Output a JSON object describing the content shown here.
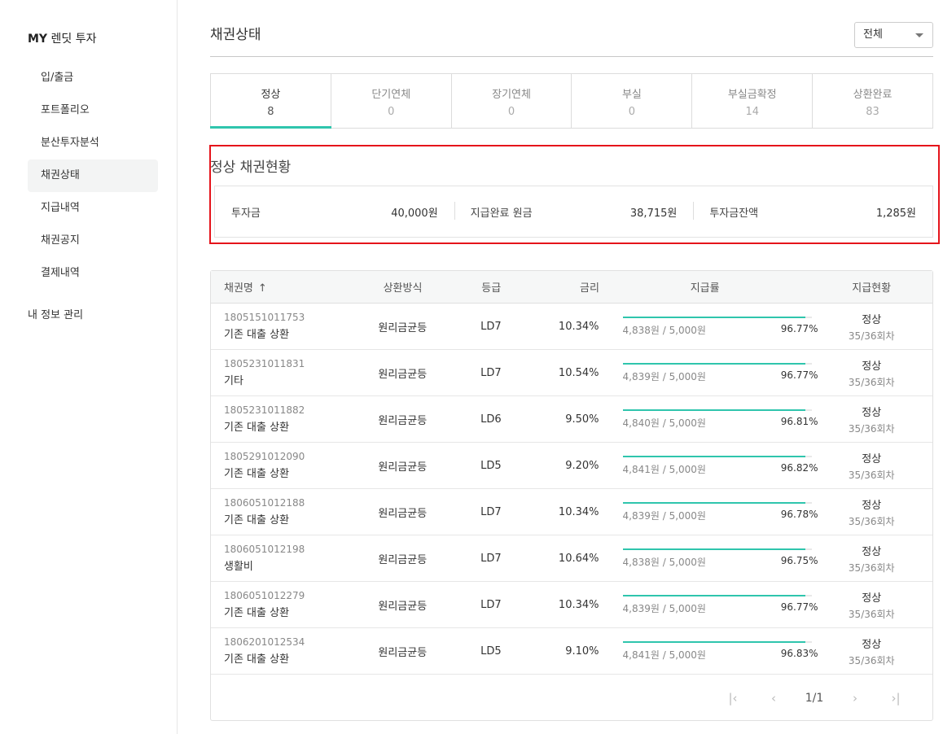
{
  "sidebar": {
    "brand_bold": "MY",
    "brand_rest": "렌딧 투자",
    "items": [
      {
        "label": "입/출금"
      },
      {
        "label": "포트폴리오"
      },
      {
        "label": "분산투자분석"
      },
      {
        "label": "채권상태"
      },
      {
        "label": "지급내역"
      },
      {
        "label": "채권공지"
      },
      {
        "label": "결제내역"
      }
    ],
    "active_index": 3,
    "account": "내 정보 관리"
  },
  "header": {
    "title": "채권상태",
    "filter_value": "전체"
  },
  "tabs": [
    {
      "label": "정상",
      "count": "8"
    },
    {
      "label": "단기연체",
      "count": "0"
    },
    {
      "label": "장기연체",
      "count": "0"
    },
    {
      "label": "부실",
      "count": "0"
    },
    {
      "label": "부실금확정",
      "count": "14"
    },
    {
      "label": "상환완료",
      "count": "83"
    }
  ],
  "summary": {
    "title": "정상 채권현황",
    "invest_label": "투자금",
    "invest_value": "40,000원",
    "paid_label": "지급완료 원금",
    "paid_value": "38,715원",
    "balance_label": "투자금잔액",
    "balance_value": "1,285원"
  },
  "table": {
    "headers": {
      "name": "채권명",
      "sort_icon": "↑",
      "method": "상환방식",
      "grade": "등급",
      "rate": "금리",
      "payout": "지급률",
      "status": "지급현황"
    },
    "rows": [
      {
        "id": "1805151011753",
        "name": "기존 대출 상환",
        "method": "원리금균등",
        "grade": "LD7",
        "rate": "10.34%",
        "paid": "4,838원 / 5,000원",
        "pct": "96.77%",
        "pct_value": 96.77,
        "status": "정상",
        "rounds": "35/36회차"
      },
      {
        "id": "1805231011831",
        "name": "기타",
        "method": "원리금균등",
        "grade": "LD7",
        "rate": "10.54%",
        "paid": "4,839원 / 5,000원",
        "pct": "96.77%",
        "pct_value": 96.77,
        "status": "정상",
        "rounds": "35/36회차"
      },
      {
        "id": "1805231011882",
        "name": "기존 대출 상환",
        "method": "원리금균등",
        "grade": "LD6",
        "rate": "9.50%",
        "paid": "4,840원 / 5,000원",
        "pct": "96.81%",
        "pct_value": 96.81,
        "status": "정상",
        "rounds": "35/36회차"
      },
      {
        "id": "1805291012090",
        "name": "기존 대출 상환",
        "method": "원리금균등",
        "grade": "LD5",
        "rate": "9.20%",
        "paid": "4,841원 / 5,000원",
        "pct": "96.82%",
        "pct_value": 96.82,
        "status": "정상",
        "rounds": "35/36회차"
      },
      {
        "id": "1806051012188",
        "name": "기존 대출 상환",
        "method": "원리금균등",
        "grade": "LD7",
        "rate": "10.34%",
        "paid": "4,839원 / 5,000원",
        "pct": "96.78%",
        "pct_value": 96.78,
        "status": "정상",
        "rounds": "35/36회차"
      },
      {
        "id": "1806051012198",
        "name": "생활비",
        "method": "원리금균등",
        "grade": "LD7",
        "rate": "10.64%",
        "paid": "4,838원 / 5,000원",
        "pct": "96.75%",
        "pct_value": 96.75,
        "status": "정상",
        "rounds": "35/36회차"
      },
      {
        "id": "1806051012279",
        "name": "기존 대출 상환",
        "method": "원리금균등",
        "grade": "LD7",
        "rate": "10.34%",
        "paid": "4,839원 / 5,000원",
        "pct": "96.77%",
        "pct_value": 96.77,
        "status": "정상",
        "rounds": "35/36회차"
      },
      {
        "id": "1806201012534",
        "name": "기존 대출 상환",
        "method": "원리금균등",
        "grade": "LD5",
        "rate": "9.10%",
        "paid": "4,841원 / 5,000원",
        "pct": "96.83%",
        "pct_value": 96.83,
        "status": "정상",
        "rounds": "35/36회차"
      }
    ]
  },
  "pagination": {
    "text": "1/1",
    "first_icon": "first-page-icon",
    "prev_icon": "prev-page-icon",
    "next_icon": "next-page-icon",
    "last_icon": "last-page-icon"
  },
  "colors": {
    "accent": "#2fc5ad",
    "highlight_border": "#e5141b"
  }
}
